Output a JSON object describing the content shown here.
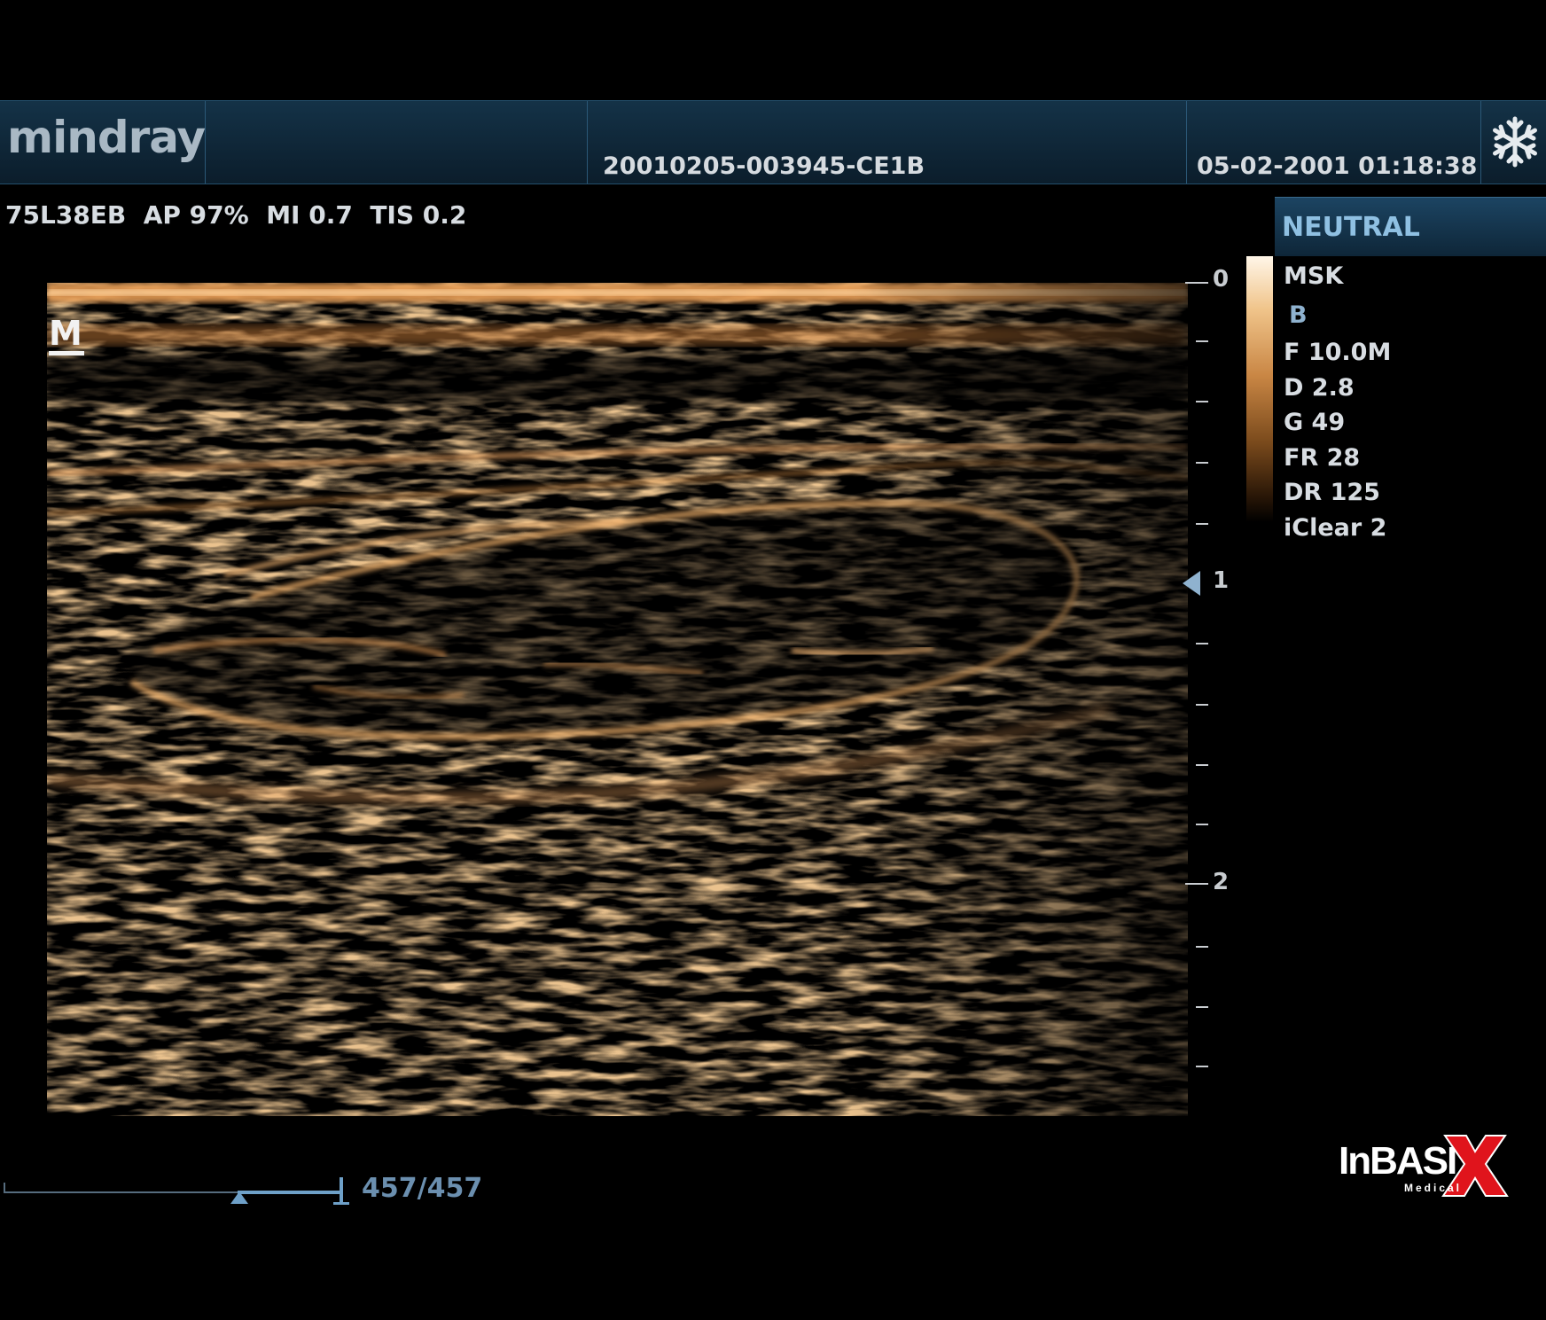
{
  "header": {
    "brand": "mindray",
    "patient_id": "20010205-003945-CE1B",
    "datetime": "05-02-2001 01:18:38",
    "freeze_icon": "snowflake-icon"
  },
  "status_line": "75L38EB  AP 97%  MI 0.7  TIS 0.2",
  "orientation_marker": "M",
  "depth_scale": {
    "unit_labels": [
      "0",
      "1",
      "2"
    ],
    "focus_depth_cm": 1.0
  },
  "panel": {
    "preset": "NEUTRAL",
    "exam": "MSK",
    "mode": "B",
    "params": [
      "F 10.0M",
      "D 2.8",
      "G 49",
      "FR 28",
      "DR 125",
      "iClear 2"
    ]
  },
  "cine": {
    "frame_counter": "457/457",
    "position_fraction": 1.0
  },
  "watermark": {
    "text": "InBASI",
    "accent": "X",
    "sub": "Medical"
  },
  "colors": {
    "header_bg": "#143247",
    "accent_blue": "#8fc0e2",
    "echo_orange": "#d08a45",
    "watermark_red": "#e0141c"
  }
}
